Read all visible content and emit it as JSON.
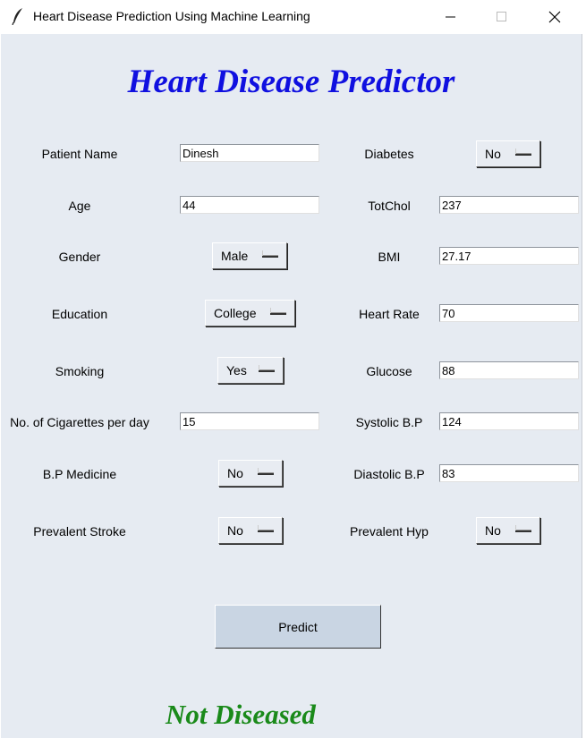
{
  "window": {
    "title": "Heart Disease Prediction Using Machine Learning",
    "icon": "feather-icon"
  },
  "heading": "Heart Disease Predictor",
  "left_fields": {
    "patient_name": {
      "label": "Patient Name",
      "value": "Dinesh"
    },
    "age": {
      "label": "Age",
      "value": "44"
    },
    "gender": {
      "label": "Gender",
      "value": "Male"
    },
    "education": {
      "label": "Education",
      "value": "College"
    },
    "smoking": {
      "label": "Smoking",
      "value": "Yes"
    },
    "cigs_per_day": {
      "label": "No. of Cigarettes per day",
      "value": "15"
    },
    "bp_medicine": {
      "label": "B.P Medicine",
      "value": "No"
    },
    "prevalent_stroke": {
      "label": "Prevalent Stroke",
      "value": "No"
    }
  },
  "right_fields": {
    "diabetes": {
      "label": "Diabetes",
      "value": "No"
    },
    "totchol": {
      "label": "TotChol",
      "value": "237"
    },
    "bmi": {
      "label": "BMI",
      "value": "27.17"
    },
    "heart_rate": {
      "label": "Heart Rate",
      "value": "70"
    },
    "glucose": {
      "label": "Glucose",
      "value": "88"
    },
    "systolic_bp": {
      "label": "Systolic B.P",
      "value": "124"
    },
    "diastolic_bp": {
      "label": "Diastolic B.P",
      "value": "83"
    },
    "prevalent_hyp": {
      "label": "Prevalent Hyp",
      "value": "No"
    }
  },
  "predict_label": "Predict",
  "result": "Not Diseased",
  "colors": {
    "heading": "#1010e0",
    "result": "#1a8a1a",
    "background": "#e6ebf2",
    "button": "#c9d5e3"
  }
}
